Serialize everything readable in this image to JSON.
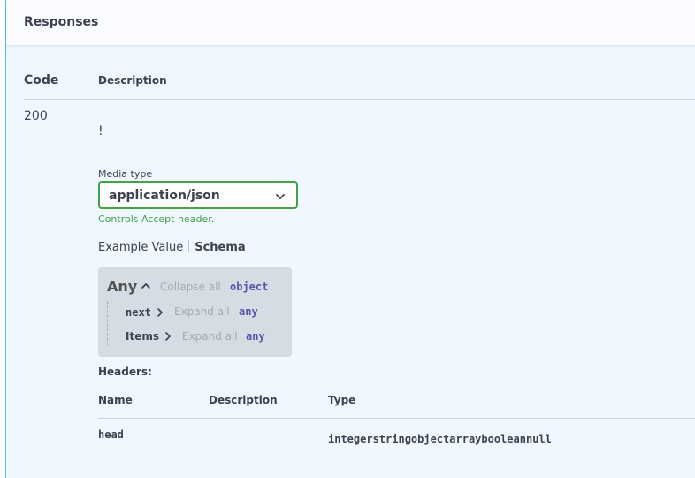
{
  "section": {
    "title": "Responses"
  },
  "table": {
    "code_header": "Code",
    "description_header": "Description"
  },
  "response": {
    "code": "200",
    "description": "!",
    "media_type": {
      "label": "Media type",
      "selected": "application/json",
      "hint": "Controls Accept header."
    },
    "tabs": {
      "example_value": "Example Value",
      "schema": "Schema",
      "active": "Schema"
    },
    "schema": {
      "title": "Any",
      "collapse_all": "Collapse all",
      "type": "object",
      "properties": [
        {
          "name": "next",
          "expand_all": "Expand all",
          "type": "any"
        },
        {
          "name": "Items",
          "expand_all": "Expand all",
          "type": "any"
        }
      ]
    },
    "headers": {
      "label": "Headers:",
      "columns": {
        "name": "Name",
        "description": "Description",
        "type": "Type"
      },
      "rows": [
        {
          "name": "head",
          "description": "",
          "type": "integerstringobjectarraybooleannull"
        }
      ]
    }
  },
  "colors": {
    "panel_border": "#61affe",
    "panel_bg": "#eff7ff",
    "select_border": "#41a346",
    "hint_text": "#41a346",
    "schema_bg": "#d6dce3",
    "type_keyword": "#5555aa"
  }
}
